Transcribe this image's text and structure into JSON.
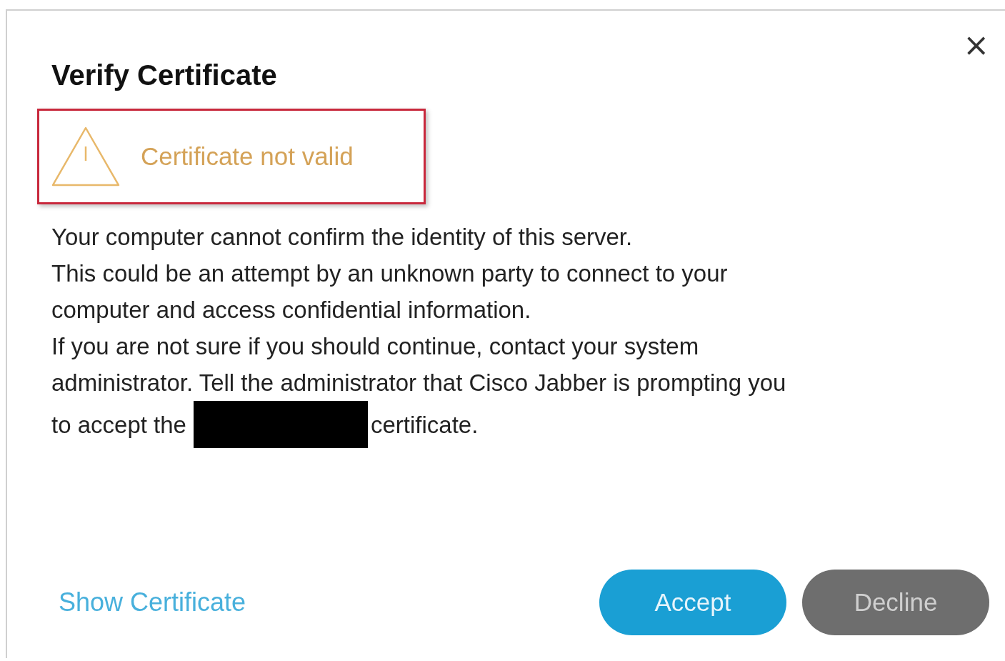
{
  "dialog": {
    "title": "Verify Certificate",
    "close": "×"
  },
  "warning": {
    "text": "Certificate not valid"
  },
  "message_lines": [
    "Your computer cannot confirm the identity of this server.",
    "This could be an attempt by an unknown party to connect to your",
    "computer and access confidential information.",
    "If you are not sure if you should continue, contact your system",
    "administrator. Tell the administrator that Cisco Jabber is prompting you"
  ],
  "last_line": {
    "before": "to accept the",
    "after": "certificate."
  },
  "link": "Show Certificate",
  "buttons": [
    {
      "label": "Accept",
      "kind": "primary"
    },
    {
      "label": "Decline",
      "kind": "secondary"
    }
  ]
}
